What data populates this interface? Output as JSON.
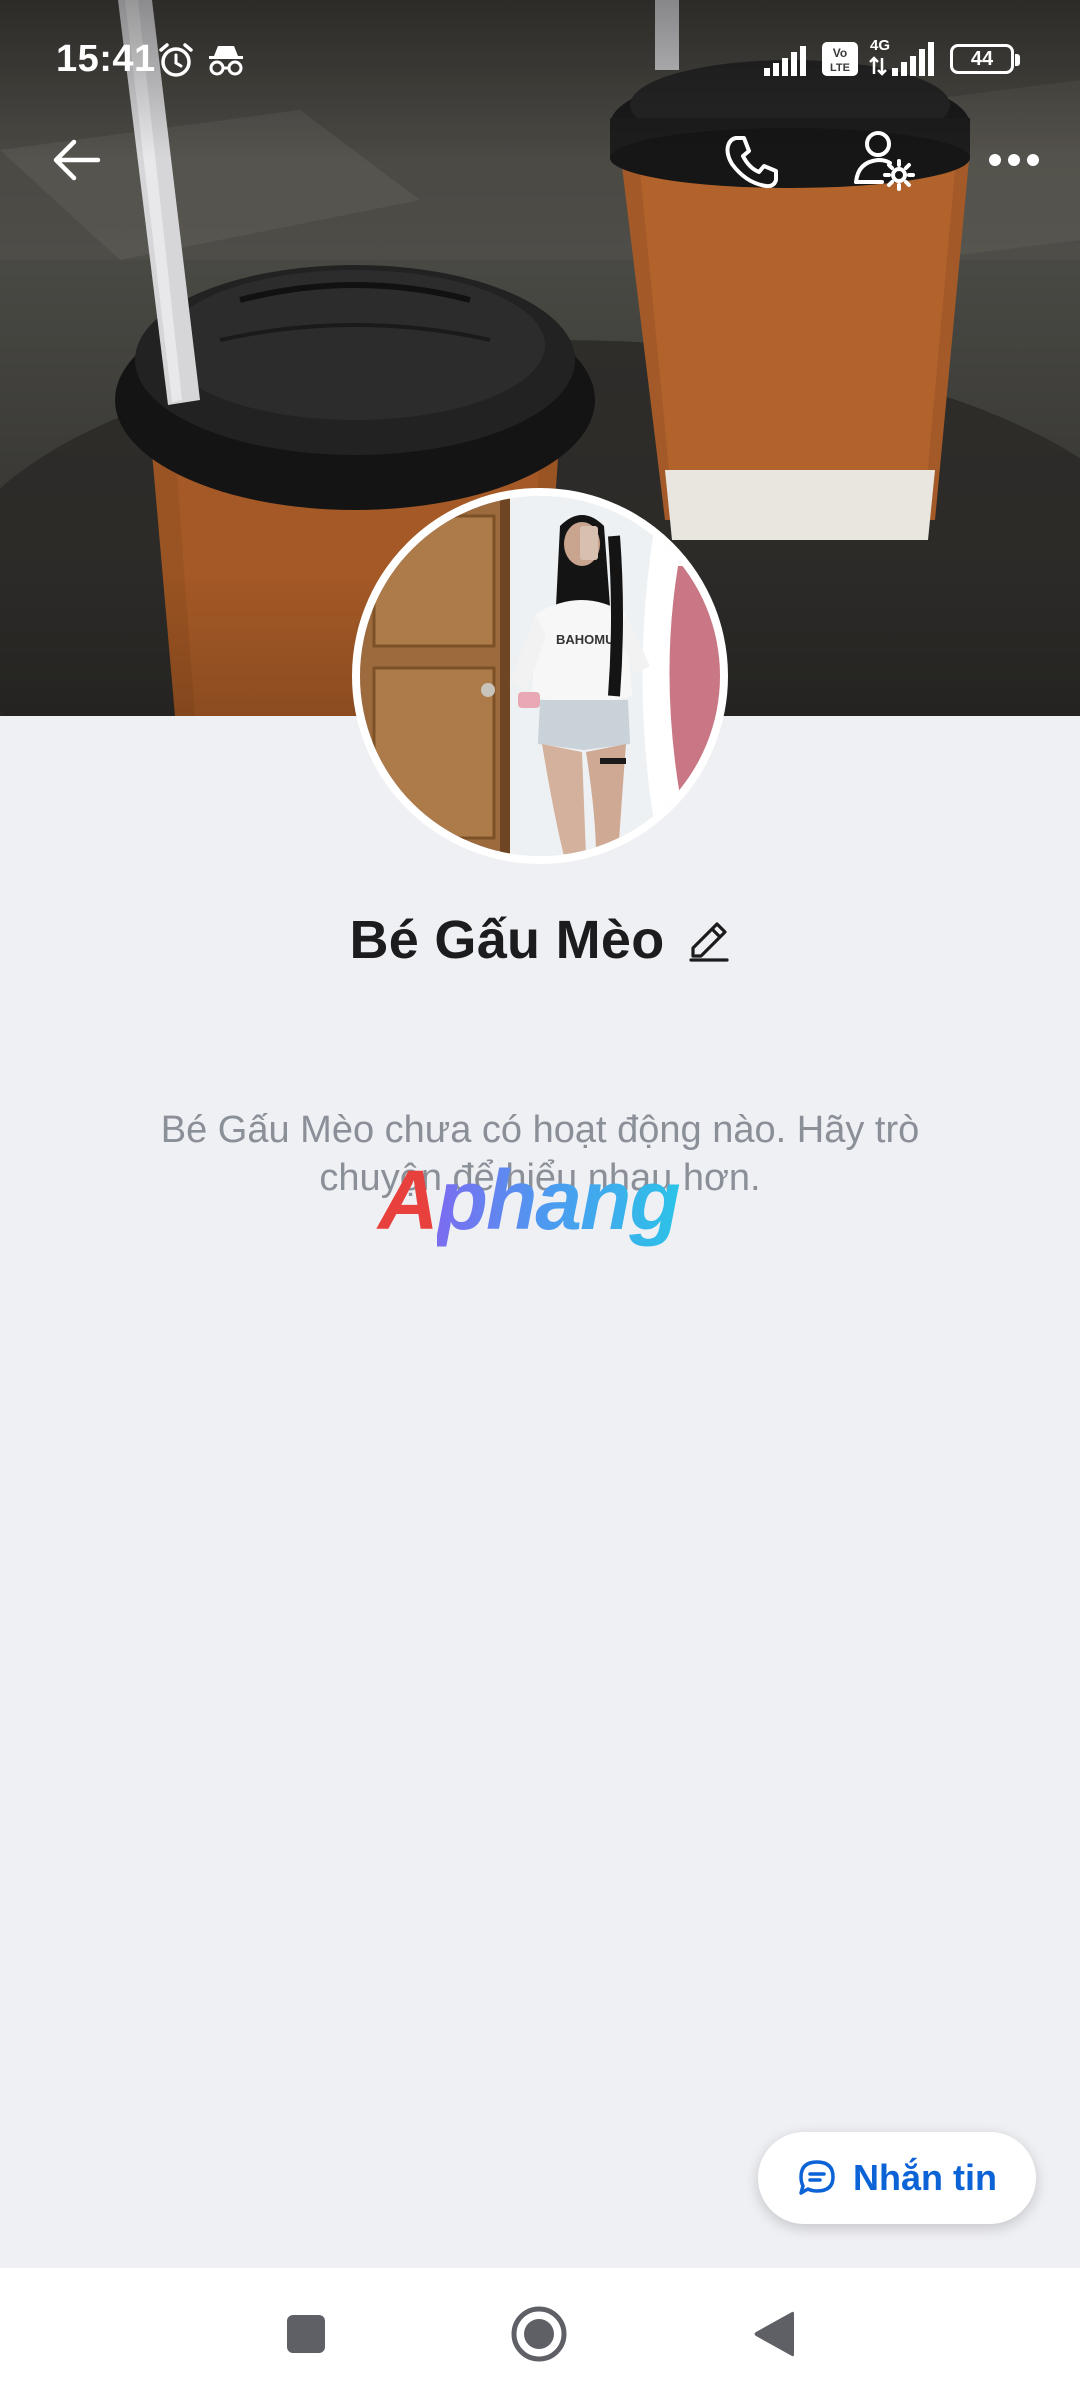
{
  "status_bar": {
    "time": "15:41",
    "battery": "44",
    "network": "4G",
    "volte": "Vo LTE",
    "icons": [
      "alarm-icon",
      "incognito-icon",
      "signal-icon",
      "volte-icon",
      "signal-4g-icon",
      "battery-icon"
    ]
  },
  "top_bar": {
    "icons": [
      "back-arrow-icon",
      "phone-icon",
      "user-settings-icon",
      "more-options-icon"
    ]
  },
  "profile": {
    "name": "Bé Gấu Mèo",
    "edit_icon": "pencil-icon"
  },
  "activity": {
    "empty_message": "Bé Gấu Mèo chưa có hoạt động nào. Hãy trò chuyện để hiểu nhau hơn."
  },
  "watermark": {
    "first_letter": "A",
    "rest": "phang"
  },
  "actions": {
    "message_label": "Nhắn tin",
    "message_icon": "chat-bubble-icon"
  },
  "nav_bar": {
    "icons": [
      "recent-apps-icon",
      "home-icon",
      "back-icon"
    ]
  },
  "colors": {
    "accent": "#0c63d6",
    "background": "#eff0f4",
    "muted_text": "#8a8f98"
  }
}
